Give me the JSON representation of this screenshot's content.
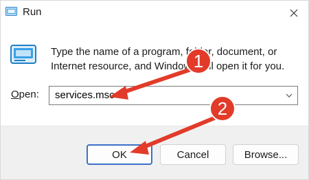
{
  "window": {
    "title": "Run",
    "close_glyph": "✕",
    "icon": "run-app-icon"
  },
  "body": {
    "description": "Type the name of a program, folder, document, or Internet resource, and Windows will open it for you.",
    "open_label_underlined": "O",
    "open_label_rest": "pen:",
    "input_value": "services.msc"
  },
  "buttons": {
    "ok": "OK",
    "cancel": "Cancel",
    "browse": "Browse..."
  },
  "annotations": {
    "step1": "1",
    "step2": "2",
    "marker_color": "#e23b2a"
  }
}
